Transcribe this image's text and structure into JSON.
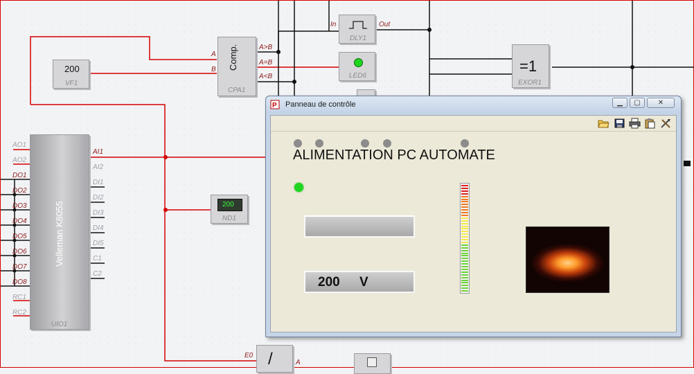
{
  "colors": {
    "wire": "#d40000",
    "signal": "#111111",
    "accent_green": "#1fd61f",
    "panel_bg": "#ece9d8"
  },
  "blocks": {
    "vf1": {
      "value": "200",
      "label": "VF1"
    },
    "comp": {
      "text": "Comp.",
      "label": "CPA1",
      "in_a": "A",
      "in_b": "B",
      "out_gt": "A>B",
      "out_eq": "A=B",
      "out_lt": "A<B"
    },
    "dly": {
      "label": "DLY1",
      "in": "In",
      "out": "Out"
    },
    "led": {
      "label": "LED6"
    },
    "exor": {
      "text": "=1",
      "label": "EXOR1"
    },
    "nd1": {
      "value": "200",
      "label": "ND1"
    },
    "velleman": {
      "title": "Velleman K8055",
      "label": "UIO1",
      "left_ports": [
        "AO1",
        "AO2",
        "DO1",
        "DO2",
        "DO3",
        "DO4",
        "DO5",
        "DO6",
        "DO7",
        "DO8",
        "RC1",
        "RC2"
      ],
      "right_ports": [
        "AI1",
        "AI2",
        "DI1",
        "DI2",
        "DI3",
        "DI4",
        "DI5",
        "C1",
        "C2"
      ]
    },
    "e0": {
      "in": "E0",
      "out": "A"
    }
  },
  "panel": {
    "title": "Panneau de contrôle",
    "window_buttons": [
      "minimize-icon",
      "maximize-icon",
      "close-icon"
    ],
    "toolbar_icons": [
      "open-folder-icon",
      "save-icon",
      "print-icon",
      "paste-icon",
      "tools-icon"
    ],
    "heading": "ALIMENTATION PC AUTOMATE",
    "display_value": "200",
    "display_unit": "V"
  }
}
